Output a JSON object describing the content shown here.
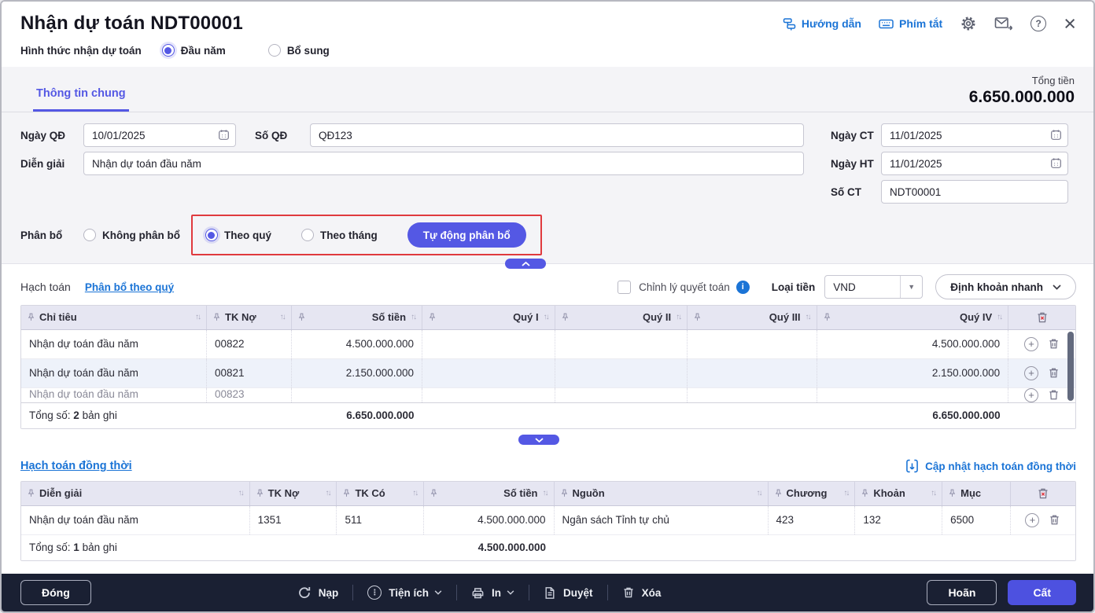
{
  "header": {
    "title": "Nhận dự toán NDT00001",
    "guide_link": "Hướng dẫn",
    "shortcut_link": "Phím tắt",
    "form_type": {
      "label": "Hình thức nhận dự toán",
      "options": [
        {
          "label": "Đầu năm",
          "selected": true
        },
        {
          "label": "Bổ sung",
          "selected": false
        }
      ]
    }
  },
  "tabs": {
    "general": "Thông tin chung"
  },
  "total": {
    "label": "Tổng tiền",
    "value": "6.650.000.000"
  },
  "form": {
    "ngay_qd": {
      "label": "Ngày QĐ",
      "value": "10/01/2025"
    },
    "so_qd": {
      "label": "Số QĐ",
      "value": "QĐ123"
    },
    "dien_giai": {
      "label": "Diễn giải",
      "value": "Nhận dự toán đầu năm"
    },
    "ngay_ct": {
      "label": "Ngày CT",
      "value": "11/01/2025"
    },
    "ngay_ht": {
      "label": "Ngày HT",
      "value": "11/01/2025"
    },
    "so_ct": {
      "label": "Số CT",
      "value": "NDT00001"
    }
  },
  "allocation": {
    "label": "Phân bổ",
    "options": [
      {
        "label": "Không phân bổ",
        "selected": false
      },
      {
        "label": "Theo quý",
        "selected": true
      },
      {
        "label": "Theo tháng",
        "selected": false
      }
    ],
    "auto_button": "Tự động phân bổ"
  },
  "accounting": {
    "title": "Hạch toán",
    "alloc_link": "Phân bổ theo quý",
    "checkbox_label": "Chỉnh lý quyết toán",
    "currency_label": "Loại tiền",
    "currency_value": "VND",
    "quick_entry_button": "Định khoản nhanh",
    "columns": [
      "Chỉ tiêu",
      "TK Nợ",
      "Số tiền",
      "Quý I",
      "Quý II",
      "Quý III",
      "Quý IV"
    ],
    "rows": [
      {
        "chi_tieu": "Nhận dự toán đầu năm",
        "tk_no": "00822",
        "so_tien": "4.500.000.000",
        "quy1": "",
        "quy2": "",
        "quy3": "",
        "quy4": "4.500.000.000"
      },
      {
        "chi_tieu": "Nhận dự toán đầu năm",
        "tk_no": "00821",
        "so_tien": "2.150.000.000",
        "quy1": "",
        "quy2": "",
        "quy3": "",
        "quy4": "2.150.000.000"
      }
    ],
    "partial_row": {
      "chi_tieu": "Nhận dự toán đầu năm",
      "tk_no": "00823"
    },
    "footer": {
      "label": "Tổng số:",
      "count": "2",
      "unit": "bản ghi",
      "total_so_tien": "6.650.000.000",
      "total_quy4": "6.650.000.000"
    }
  },
  "simultaneous": {
    "title": "Hạch toán đồng thời",
    "update_link": "Cập nhật hạch toán đồng thời",
    "columns": [
      "Diễn giải",
      "TK Nợ",
      "TK Có",
      "Số tiền",
      "Nguồn",
      "Chương",
      "Khoản",
      "Mục"
    ],
    "rows": [
      {
        "dien_giai": "Nhận dự toán đầu năm",
        "tk_no": "1351",
        "tk_co": "511",
        "so_tien": "4.500.000.000",
        "nguon": "Ngân sách Tỉnh tự chủ",
        "chuong": "423",
        "khoan": "132",
        "muc": "6500"
      }
    ],
    "footer": {
      "label": "Tổng số:",
      "count": "1",
      "unit": "bản ghi",
      "total": "4.500.000.000"
    }
  },
  "footer_bar": {
    "close": "Đóng",
    "reload": "Nạp",
    "utilities": "Tiện ích",
    "print": "In",
    "approve": "Duyệt",
    "delete": "Xóa",
    "postpone": "Hoãn",
    "save": "Cất"
  },
  "colors": {
    "accent": "#5458e4",
    "link_blue": "#1b74d6",
    "highlight_red": "#e03a3e",
    "footer_dark": "#1a2033",
    "table_header_bg": "#e6e6f2",
    "row_alt_bg": "#eef2fa"
  }
}
